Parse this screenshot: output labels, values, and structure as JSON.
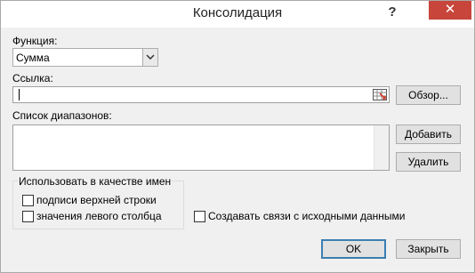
{
  "window": {
    "title": "Консолидация",
    "help_glyph": "?",
    "close_glyph": "✕"
  },
  "function": {
    "label": "Функция:",
    "value": "Сумма"
  },
  "reference": {
    "label": "Ссылка:",
    "value": ""
  },
  "browse_button": "Обзор...",
  "ranges": {
    "label": "Список диапазонов:",
    "items": []
  },
  "add_button": "Добавить",
  "delete_button": "Удалить",
  "labels_group": {
    "title": "Использовать в качестве имен",
    "top_row": {
      "label": "подписи верхней строки",
      "checked": false
    },
    "left_column": {
      "label": "значения левого столбца",
      "checked": false
    }
  },
  "links": {
    "label": "Создавать связи с исходными данными",
    "checked": false
  },
  "ok_button": "OK",
  "close_button": "Закрыть"
}
